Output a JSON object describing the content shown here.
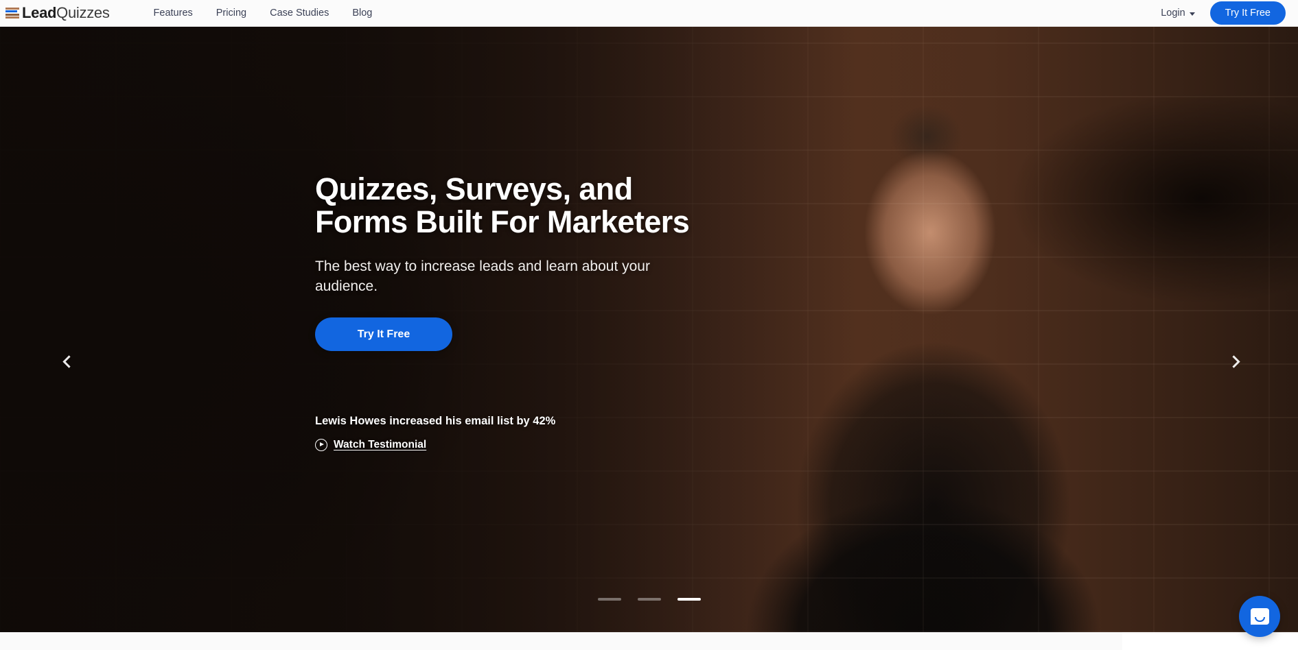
{
  "brand": {
    "name_bold": "Lead",
    "name_light": "Quizzes",
    "logo_icon": "lead-quizzes-bars-logo",
    "bar_colors": [
      "#b07a55",
      "#1266e0",
      "#8b5e3c",
      "#b07a55"
    ]
  },
  "nav": {
    "links": [
      {
        "label": "Features"
      },
      {
        "label": "Pricing"
      },
      {
        "label": "Case Studies"
      },
      {
        "label": "Blog"
      }
    ],
    "login_label": "Login",
    "login_caret_icon": "chevron-down-icon",
    "cta_label": "Try It Free",
    "cta_color": "#1266e0"
  },
  "hero": {
    "title": "Quizzes, Surveys, and\nForms Built For Marketers",
    "subtitle": "The best way to increase leads and learn about your\naudience.",
    "cta_label": "Try It Free",
    "cta_color": "#1266e0",
    "testimonial_text": "Lewis Howes increased his email list by 42%",
    "watch_label": "Watch Testimonial",
    "play_icon": "play-circle-icon",
    "prev_icon": "chevron-left-icon",
    "next_icon": "chevron-right-icon",
    "slides": [
      {
        "active": false
      },
      {
        "active": false
      },
      {
        "active": true
      }
    ]
  },
  "chat": {
    "icon": "intercom-chat-bubble-icon",
    "color": "#1266e0"
  }
}
